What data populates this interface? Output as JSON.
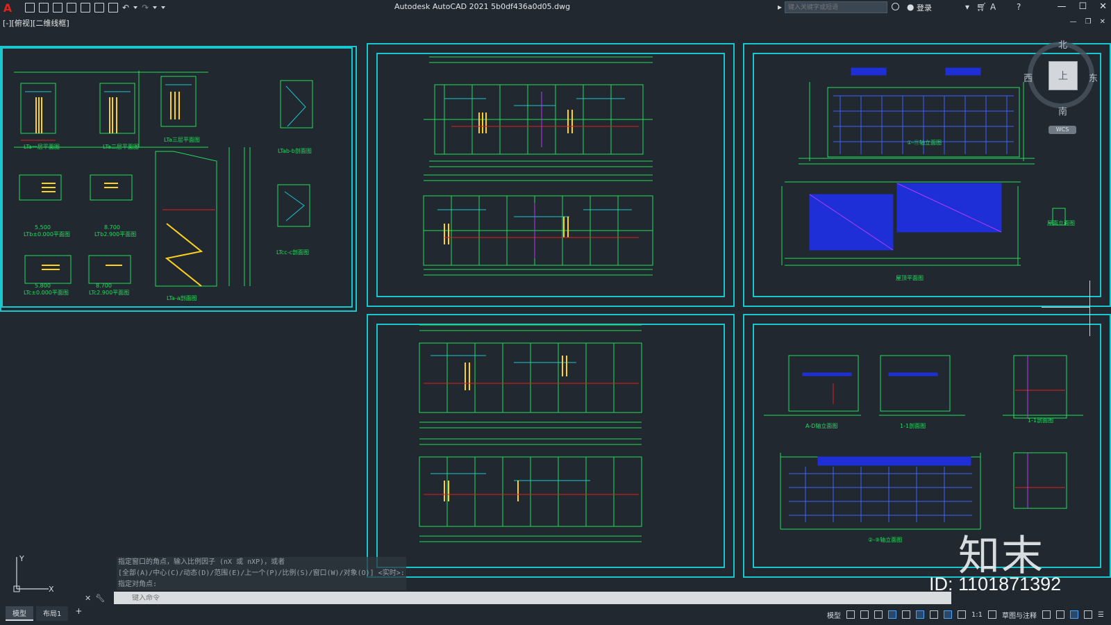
{
  "titlebar": {
    "app": "A",
    "title": "Autodesk AutoCAD 2021    5b0df436a0d05.dwg",
    "search_placeholder": "键入关键字或短语",
    "login": "登录",
    "minimize": "—",
    "maximize": "☐",
    "close": "✕"
  },
  "viewport": {
    "label": "[-][俯视][二维线框]",
    "controls": [
      "—",
      "❐",
      "✕"
    ]
  },
  "viewcube": {
    "face": "上",
    "north": "北",
    "south": "南",
    "east": "东",
    "west": "西",
    "wcs": "WCS"
  },
  "sheets": {
    "s1": {
      "labels": [
        "LTa一层平面图",
        "LTa二层平面图",
        "LTa三层平面图",
        "LTab-b剖面图",
        "5.500",
        "LTb±0.000平面图",
        "8.700",
        "LTb2.900平面图",
        "LTa-a剖面图",
        "LTcc-c剖面图",
        "5.800",
        "LTc±0.000平面图",
        "8.700",
        "LTc2.900平面图"
      ]
    },
    "s3": {
      "labels": [
        "①-⑪轴立面图",
        "屋顶平面图",
        "屋面立面图"
      ]
    },
    "s5": {
      "labels": [
        "A-D轴立面图",
        "1-1剖面图",
        "②-⑨轴立面图",
        "1-1剖面图"
      ]
    }
  },
  "command": {
    "history": [
      "指定窗口的角点，输入比例因子 (nX 或 nXP)，或者",
      "[全部(A)/中心(C)/动态(D)/范围(E)/上一个(P)/比例(S)/窗口(W)/对象(O)] <实时>:",
      "指定对角点:"
    ],
    "placeholder": "键入命令"
  },
  "tabs": [
    "模型",
    "布局1"
  ],
  "statusbar": {
    "model": "模型",
    "scale": "1:1",
    "workspace": "草图与注释"
  },
  "ucs": {
    "x": "X",
    "y": "Y"
  },
  "watermark": {
    "logo": "知末",
    "id": "ID: 1101871392"
  },
  "colors": {
    "sheet_border": "#19c7cf",
    "background": "#212830",
    "cad_green": "#1fe05a",
    "cad_blue": "#1f2fd8"
  }
}
